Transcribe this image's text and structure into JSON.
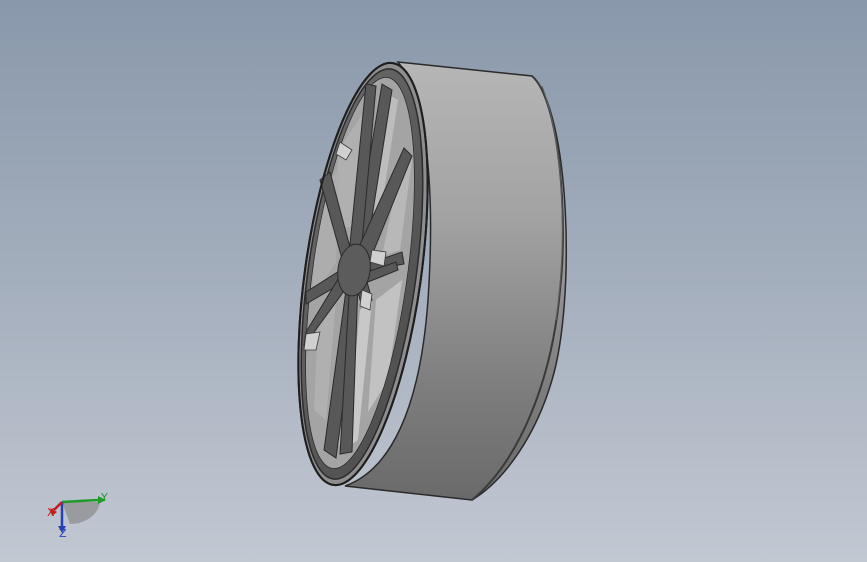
{
  "viewport": {
    "background_top": "#8998ab",
    "background_bottom": "#c2c8d2"
  },
  "model": {
    "part": "wheel-rim-with-eight-spokes",
    "face_color": "#5a5a5a",
    "rim_color": "#a9a9a9",
    "spoke_count": 8
  },
  "triad": {
    "x_label": "X",
    "y_label": "Y",
    "z_label": "Z",
    "x_color": "#c31d1d",
    "y_color": "#1f9a2b",
    "z_color": "#2740b8"
  }
}
